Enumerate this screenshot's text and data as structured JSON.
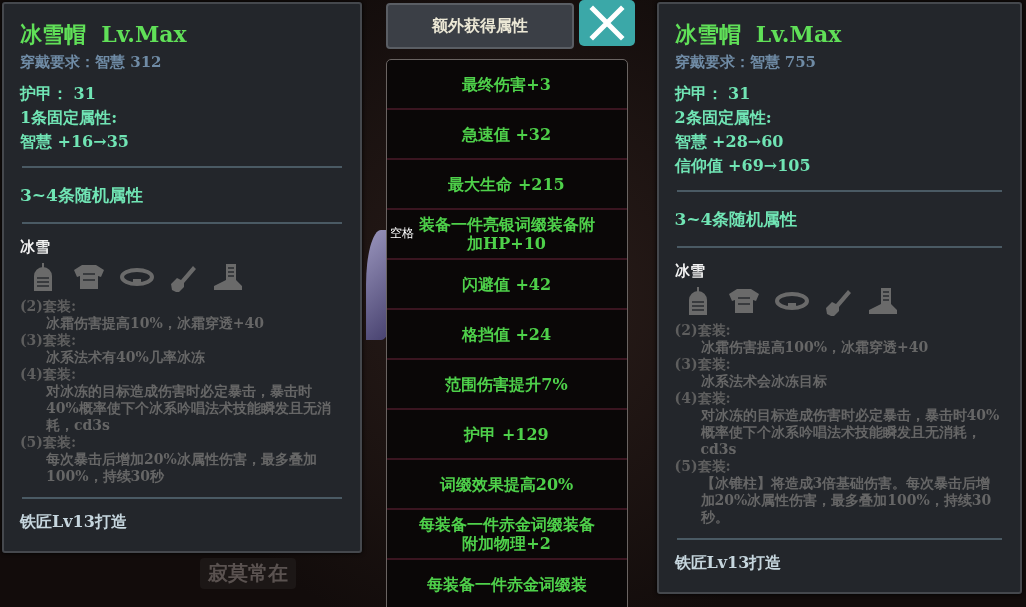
{
  "panels": [
    {
      "name": "冰雪帽",
      "level": "Lv.Max",
      "requirement": "穿戴要求：智慧  312",
      "armor": "护甲：  31",
      "fixed_header": "1条固定属性:",
      "fixed": [
        "智慧  +16→35"
      ],
      "random_header": "3~4条随机属性",
      "set_name": "冰雪",
      "set_bonuses": [
        {
          "label": "(2)套装:",
          "text": "冰霜伤害提高10%，冰霜穿透+40"
        },
        {
          "label": "(3)套装:",
          "text": "冰系法术有40%几率冰冻"
        },
        {
          "label": "(4)套装:",
          "text": "对冰冻的目标造成伤害时必定暴击，暴击时40%概率使下个冰系吟唱法术技能瞬发且无消耗，cd3s"
        },
        {
          "label": "(5)套装:",
          "text": "每次暴击后增加20%冰属性伤害，最多叠加100%，持续30秒"
        }
      ],
      "crafted": "铁匠Lv13打造"
    },
    {
      "name": "冰雪帽",
      "level": "Lv.Max",
      "requirement": "穿戴要求：智慧  755",
      "armor": "护甲：  31",
      "fixed_header": "2条固定属性:",
      "fixed": [
        "智慧  +28→60",
        "信仰值  +69→105"
      ],
      "random_header": "3~4条随机属性",
      "set_name": "冰雪",
      "set_bonuses": [
        {
          "label": "(2)套装:",
          "text": "冰霜伤害提高100%，冰霜穿透+40"
        },
        {
          "label": "(3)套装:",
          "text": "冰系法术会冰冻目标"
        },
        {
          "label": "(4)套装:",
          "text": "对冰冻的目标造成伤害时必定暴击，暴击时40%概率使下个冰系吟唱法术技能瞬发且无消耗，cd3s"
        },
        {
          "label": "(5)套装:",
          "text": "【冰锥柱】将造成3倍基础伤害。每次暴击后增加20%冰属性伤害，最多叠加100%，持续30秒。"
        }
      ],
      "crafted": "铁匠Lv13打造"
    }
  ],
  "extra": {
    "title": "额外获得属性",
    "rows": [
      "最终伤害+3",
      "急速值  +32",
      "最大生命  +215",
      "装备一件亮银词缀装备附加HP+10",
      "闪避值  +42",
      "格挡值  +24",
      "范围伤害提升7%",
      "护甲  +129",
      "词缀效果提高20%",
      "每装备一件赤金词缀装备附加物理+2",
      "每装备一件赤金词缀装"
    ]
  },
  "background": {
    "name_label": "寂莫常在",
    "key_hint": "空格"
  }
}
